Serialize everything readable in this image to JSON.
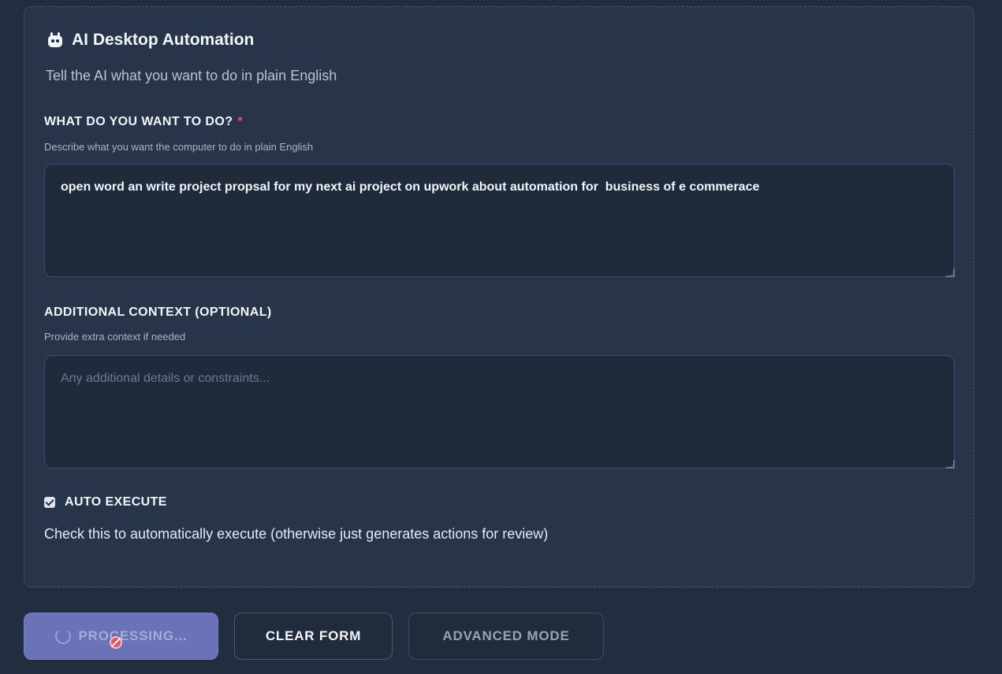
{
  "app": {
    "title": "AI Desktop Automation",
    "subtitle": "Tell the AI what you want to do in plain English",
    "icon": "robot-icon"
  },
  "task_field": {
    "label": "WHAT DO YOU WANT TO DO?",
    "required_marker": "*",
    "help": "Describe what you want the computer to do in plain English",
    "value": "open word an write project propsal for my next ai project on upwork about automation for  business of e commerace"
  },
  "context_field": {
    "label": "ADDITIONAL CONTEXT (OPTIONAL)",
    "help": "Provide extra context if needed",
    "value": "",
    "placeholder": "Any additional details or constraints..."
  },
  "auto_execute": {
    "label": "AUTO EXECUTE",
    "checked": true,
    "help": "Check this to automatically execute (otherwise just generates actions for review)"
  },
  "buttons": {
    "processing_label": "PROCESSING...",
    "clear_label": "CLEAR FORM",
    "advanced_label": "ADVANCED MODE"
  },
  "colors": {
    "background": "#222e40",
    "card": "#27344a",
    "accent": "#6a72b8",
    "required": "#e05a6b"
  }
}
